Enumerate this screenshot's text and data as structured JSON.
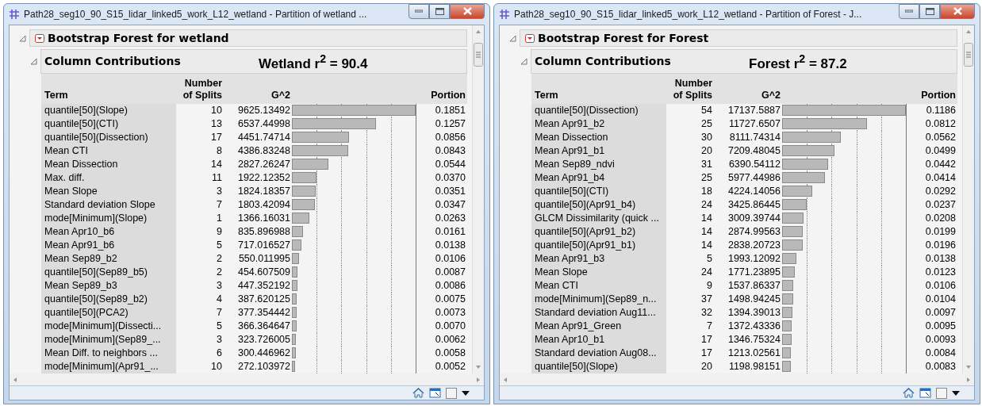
{
  "windows": [
    {
      "title": "Path28_seg10_90_S15_lidar_linked5_work_L12_wetland - Partition of wetland ...",
      "report_title": "Bootstrap Forest for wetland",
      "section_title": "Column Contributions",
      "annotation": "Wetland r$^{2}$ = 90.4",
      "columns": [
        "Term",
        "Number\nof Splits",
        "G^2",
        "Portion"
      ],
      "rows": [
        {
          "term": "quantile[50](Slope)",
          "splits": "10",
          "g2": "9625.13492",
          "portion": "0.1851",
          "level": 1
        },
        {
          "term": "quantile[50](CTI)",
          "splits": "13",
          "g2": "6537.44998",
          "portion": "0.1257",
          "level": 0.679
        },
        {
          "term": "quantile[50](Dissection)",
          "splits": "17",
          "g2": "4451.74714",
          "portion": "0.0856",
          "level": 0.462
        },
        {
          "term": "Mean CTI",
          "splits": "8",
          "g2": "4386.83248",
          "portion": "0.0843",
          "level": 0.455
        },
        {
          "term": "Mean Dissection",
          "splits": "14",
          "g2": "2827.26247",
          "portion": "0.0544",
          "level": 0.294
        },
        {
          "term": "Max. diff.",
          "splits": "11",
          "g2": "1922.12352",
          "portion": "0.0370",
          "level": 0.2
        },
        {
          "term": "Mean Slope",
          "splits": "3",
          "g2": "1824.18357",
          "portion": "0.0351",
          "level": 0.19
        },
        {
          "term": "Standard deviation Slope",
          "splits": "7",
          "g2": "1803.42094",
          "portion": "0.0347",
          "level": 0.187
        },
        {
          "term": "mode[Minimum](Slope)",
          "splits": "1",
          "g2": "1366.16031",
          "portion": "0.0263",
          "level": 0.142
        },
        {
          "term": "Mean Apr10_b6",
          "splits": "9",
          "g2": "835.896988",
          "portion": "0.0161",
          "level": 0.087
        },
        {
          "term": "Mean Apr91_b6",
          "splits": "5",
          "g2": "717.016527",
          "portion": "0.0138",
          "level": 0.075
        },
        {
          "term": "Mean Sep89_b2",
          "splits": "2",
          "g2": "550.011995",
          "portion": "0.0106",
          "level": 0.057
        },
        {
          "term": "quantile[50](Sep89_b5)",
          "splits": "2",
          "g2": "454.607509",
          "portion": "0.0087",
          "level": 0.047
        },
        {
          "term": "Mean Sep89_b3",
          "splits": "3",
          "g2": "447.352192",
          "portion": "0.0086",
          "level": 0.046
        },
        {
          "term": "quantile[50](Sep89_b2)",
          "splits": "4",
          "g2": "387.620125",
          "portion": "0.0075",
          "level": 0.041
        },
        {
          "term": "quantile[50](PCA2)",
          "splits": "7",
          "g2": "377.354442",
          "portion": "0.0073",
          "level": 0.039
        },
        {
          "term": "mode[Minimum](Dissecti...",
          "splits": "5",
          "g2": "366.364647",
          "portion": "0.0070",
          "level": 0.038
        },
        {
          "term": "mode[Minimum](Sep89_...",
          "splits": "3",
          "g2": "323.726005",
          "portion": "0.0062",
          "level": 0.033
        },
        {
          "term": "Mean Diff. to neighbors ...",
          "splits": "6",
          "g2": "300.446962",
          "portion": "0.0058",
          "level": 0.031
        },
        {
          "term": "mode[Minimum](Apr91_...",
          "splits": "10",
          "g2": "272.103972",
          "portion": "0.0052",
          "level": 0.028
        }
      ]
    },
    {
      "title": "Path28_seg10_90_S15_lidar_linked5_work_L12_wetland - Partition of Forest - J...",
      "report_title": "Bootstrap Forest for Forest",
      "section_title": "Column Contributions",
      "annotation": "Forest r$^{2}$ = 87.2",
      "columns": [
        "Term",
        "Number\nof Splits",
        "G^2",
        "Portion"
      ],
      "rows": [
        {
          "term": "quantile[50](Dissection)",
          "splits": "54",
          "g2": "17137.5887",
          "portion": "0.1186",
          "level": 1
        },
        {
          "term": "Mean Apr91_b2",
          "splits": "25",
          "g2": "11727.6507",
          "portion": "0.0812",
          "level": 0.685
        },
        {
          "term": "Mean Dissection",
          "splits": "30",
          "g2": "8111.74314",
          "portion": "0.0562",
          "level": 0.474
        },
        {
          "term": "Mean Apr91_b1",
          "splits": "20",
          "g2": "7209.48045",
          "portion": "0.0499",
          "level": 0.421
        },
        {
          "term": "Mean Sep89_ndvi",
          "splits": "31",
          "g2": "6390.54112",
          "portion": "0.0442",
          "level": 0.373
        },
        {
          "term": "Mean Apr91_b4",
          "splits": "25",
          "g2": "5977.44986",
          "portion": "0.0414",
          "level": 0.349
        },
        {
          "term": "quantile[50](CTI)",
          "splits": "18",
          "g2": "4224.14056",
          "portion": "0.0292",
          "level": 0.246
        },
        {
          "term": "quantile[50](Apr91_b4)",
          "splits": "24",
          "g2": "3425.86445",
          "portion": "0.0237",
          "level": 0.2
        },
        {
          "term": "GLCM Dissimilarity (quick ...",
          "splits": "14",
          "g2": "3009.39744",
          "portion": "0.0208",
          "level": 0.175
        },
        {
          "term": "quantile[50](Apr91_b2)",
          "splits": "14",
          "g2": "2874.99563",
          "portion": "0.0199",
          "level": 0.168
        },
        {
          "term": "quantile[50](Apr91_b1)",
          "splits": "14",
          "g2": "2838.20723",
          "portion": "0.0196",
          "level": 0.165
        },
        {
          "term": "Mean Apr91_b3",
          "splits": "5",
          "g2": "1993.12092",
          "portion": "0.0138",
          "level": 0.116
        },
        {
          "term": "Mean Slope",
          "splits": "24",
          "g2": "1771.23895",
          "portion": "0.0123",
          "level": 0.104
        },
        {
          "term": "Mean CTI",
          "splits": "9",
          "g2": "1537.86337",
          "portion": "0.0106",
          "level": 0.089
        },
        {
          "term": "mode[Minimum](Sep89_n...",
          "splits": "37",
          "g2": "1498.94245",
          "portion": "0.0104",
          "level": 0.088
        },
        {
          "term": "Standard deviation Aug11...",
          "splits": "32",
          "g2": "1394.39013",
          "portion": "0.0097",
          "level": 0.082
        },
        {
          "term": "Mean Apr91_Green",
          "splits": "7",
          "g2": "1372.43336",
          "portion": "0.0095",
          "level": 0.08
        },
        {
          "term": "Mean Apr10_b1",
          "splits": "17",
          "g2": "1346.75324",
          "portion": "0.0093",
          "level": 0.078
        },
        {
          "term": "Standard deviation Aug08...",
          "splits": "17",
          "g2": "1213.02561",
          "portion": "0.0084",
          "level": 0.071
        },
        {
          "term": "quantile[50](Slope)",
          "splits": "20",
          "g2": "1198.98151",
          "portion": "0.0083",
          "level": 0.07
        }
      ]
    }
  ]
}
